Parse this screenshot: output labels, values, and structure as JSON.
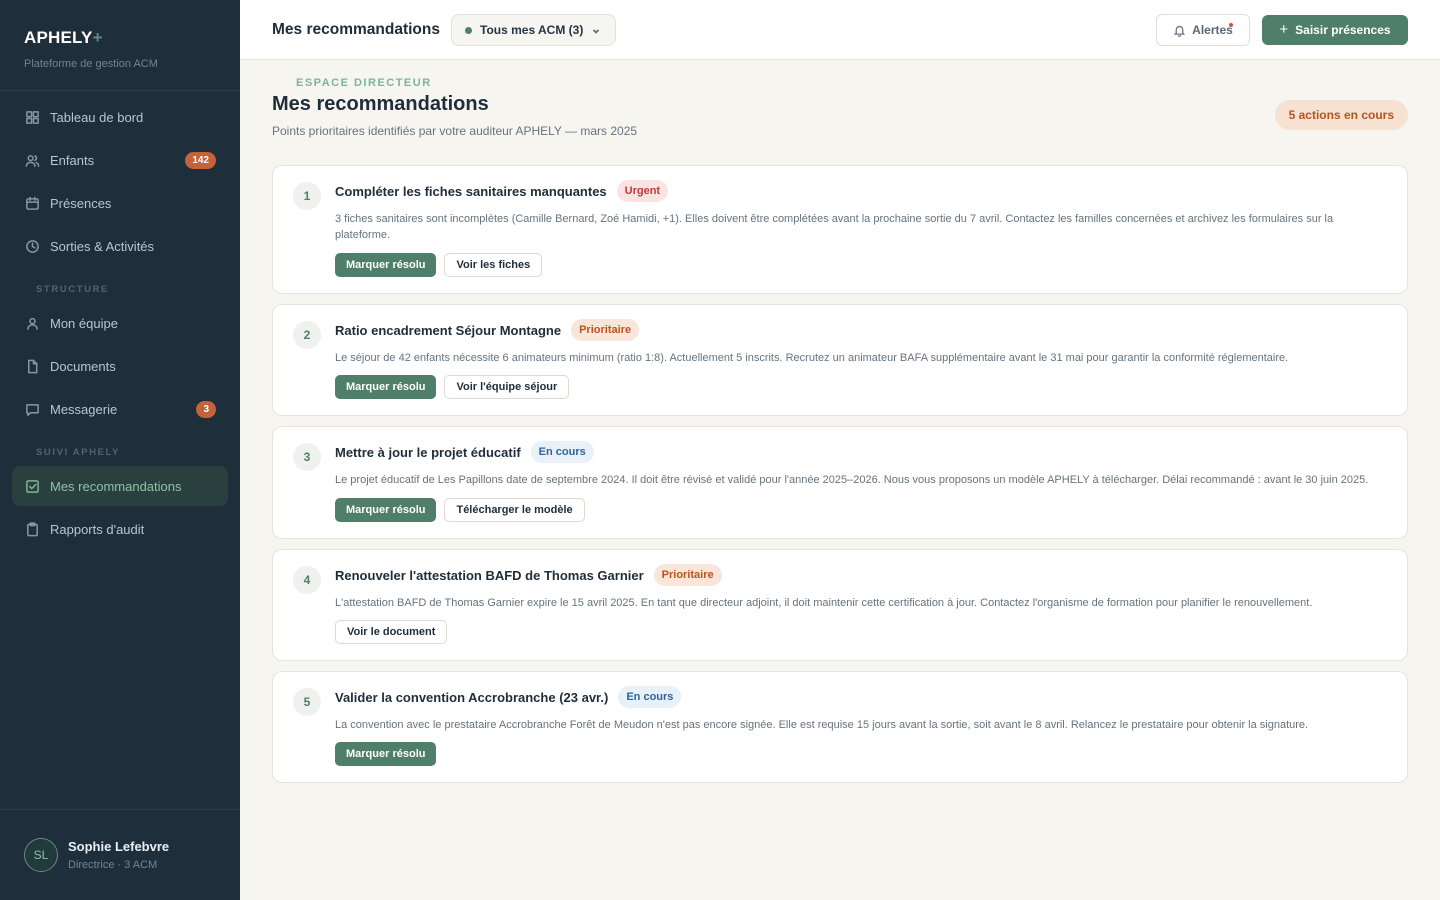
{
  "sidebar": {
    "brand": "APHELY",
    "brand_plus": "+",
    "brand_sub": "Plateforme de gestion ACM",
    "section_main": "ESPACE DIRECTEUR",
    "section_structure": "STRUCTURE",
    "section_suivi": "SUIVI APHELY",
    "items": [
      {
        "label": "Tableau de bord",
        "icon": "grid-icon"
      },
      {
        "label": "Enfants",
        "icon": "users-icon",
        "badge": "142"
      },
      {
        "label": "Présences",
        "icon": "calendar-icon"
      },
      {
        "label": "Sorties & Activités",
        "icon": "clock-icon"
      },
      {
        "label": "Mon équipe",
        "icon": "user-icon"
      },
      {
        "label": "Documents",
        "icon": "file-icon"
      },
      {
        "label": "Messagerie",
        "icon": "message-icon",
        "badge": "3"
      },
      {
        "label": "Mes recommandations",
        "icon": "check-square-icon",
        "active": true
      },
      {
        "label": "Rapports d'audit",
        "icon": "clipboard-icon"
      }
    ],
    "user": {
      "initials": "SL",
      "name": "Sophie Lefebvre",
      "role": "Directrice · 3 ACM"
    }
  },
  "topbar": {
    "title": "Mes recommandations",
    "scope": "Tous mes ACM (3)",
    "alerts_label": "Alertes",
    "primary_label": "Saisir présences",
    "primary_plus": "+"
  },
  "main": {
    "title": "Mes recommandations",
    "subtitle": "Points prioritaires identifiés par votre auditeur APHELY — mars 2025",
    "count": "5 actions en cours",
    "cards": [
      {
        "num": "1",
        "title": "Compléter les fiches sanitaires manquantes",
        "tag": "Urgent",
        "desc": "3 fiches sanitaires sont incomplètes (Camille Bernard, Zoé Hamidi, +1). Elles doivent être complétées avant la prochaine sortie du 7 avril. Contactez les familles concernées et archivez les formulaires sur la plateforme.",
        "primary": "Marquer résolu",
        "secondary": "Voir les fiches"
      },
      {
        "num": "2",
        "title": "Ratio encadrement Séjour Montagne",
        "tag": "Prioritaire",
        "desc": "Le séjour de 42 enfants nécessite 6 animateurs minimum (ratio 1:8). Actuellement 5 inscrits. Recrutez un animateur BAFA supplémentaire avant le 31 mai pour garantir la conformité réglementaire.",
        "primary": "Marquer résolu",
        "secondary": "Voir l'équipe séjour"
      },
      {
        "num": "3",
        "title": "Mettre à jour le projet éducatif",
        "tag": "En cours",
        "desc": "Le projet éducatif de Les Papillons date de septembre 2024. Il doit être révisé et validé pour l'année 2025–2026. Nous vous proposons un modèle APHELY à télécharger. Délai recommandé : avant le 30 juin 2025.",
        "primary": "Marquer résolu",
        "secondary": "Télécharger le modèle"
      },
      {
        "num": "4",
        "title": "Renouveler l'attestation BAFD de Thomas Garnier",
        "tag": "Prioritaire",
        "desc": "L'attestation BAFD de Thomas Garnier expire le 15 avril 2025. En tant que directeur adjoint, il doit maintenir cette certification à jour. Contactez l'organisme de formation pour planifier le renouvellement.",
        "secondary": "Voir le document"
      },
      {
        "num": "5",
        "title": "Valider la convention Accrobranche (23 avr.)",
        "tag": "En cours",
        "desc": "La convention avec le prestataire Accrobranche Forêt de Meudon n'est pas encore signée. Elle est requise 15 jours avant la sortie, soit avant le 8 avril. Relancez le prestataire pour obtenir la signature.",
        "primary": "Marquer résolu"
      }
    ]
  },
  "colors": {
    "sidebar_bg": "#1f2e3b",
    "accent": "#4f7f6b",
    "urgent": "#c23a3a",
    "prioritaire": "#b8531f",
    "en_cours": "#2e6597"
  }
}
